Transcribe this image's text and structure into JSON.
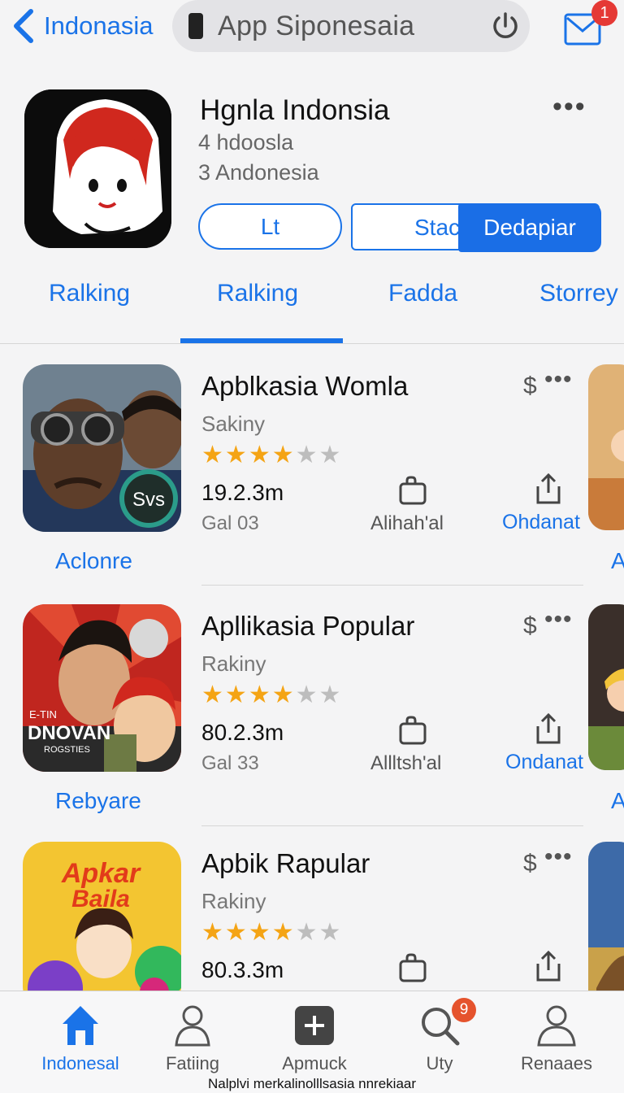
{
  "topbar": {
    "back_label": "Indonasia",
    "search_text": "App Siponesaia",
    "mail_badge": "1"
  },
  "app": {
    "title": "Hgnla Indonsia",
    "subtitle1": "4  hdoosla",
    "subtitle2": "3  Andonesia",
    "button_primary": "Lt",
    "button_secondary": "Stac",
    "button_highlight": "Dedapiar"
  },
  "tabs": [
    "Ralking",
    "Ralking",
    "Fadda",
    "Storrey"
  ],
  "rows": [
    {
      "title": "Apblkasia Womla",
      "subtitle": "Sakiny",
      "rating": 4,
      "size": "19.2.3m",
      "gal": "Gal 03",
      "action_label": "Alihah'al",
      "link": "Ohdanat",
      "caption": "Aclonre",
      "thumb_badge": "Svs",
      "peek_letter": "A"
    },
    {
      "title": "Apllikasia Popular",
      "subtitle": "Rakiny",
      "rating": 4,
      "size": "80.2.3m",
      "gal": "Gal 33",
      "action_label": "Allltsh'al",
      "link": "Ondanat",
      "caption": "Rebyare",
      "thumb_text1": "E-TIN",
      "thumb_text2": "DNOVAN",
      "thumb_text3": "ROGSTIES",
      "peek_letter": "A"
    },
    {
      "title": "Apbik Rapular",
      "subtitle": "Rakiny",
      "rating": 4,
      "size": "80.3.3m",
      "thumb_text1": "Apkar",
      "thumb_text2": "Baila"
    }
  ],
  "bottom_nav": {
    "items": [
      {
        "label": "Indonesal",
        "icon": "home-icon",
        "active": true
      },
      {
        "label": "Fatiing",
        "icon": "person-icon"
      },
      {
        "label": "Apmuck",
        "icon": "add-icon"
      },
      {
        "label": "Uty",
        "icon": "search-icon",
        "badge": "9"
      },
      {
        "label": "Renaaes",
        "icon": "profile-icon"
      }
    ]
  },
  "footnote": "Nalplvi merkalinolllsasia nnrekiaar",
  "colors": {
    "accent": "#1a73e8",
    "star": "#f4a415",
    "badge": "#e53935",
    "background": "#f4f4f5"
  }
}
